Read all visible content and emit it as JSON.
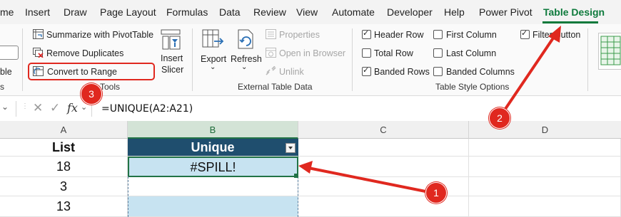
{
  "menu": {
    "items": [
      "me",
      "Insert",
      "Draw",
      "Page Layout",
      "Formulas",
      "Data",
      "Review",
      "View",
      "Automate",
      "Developer",
      "Help",
      "Power Pivot",
      "Table Design"
    ],
    "active": "Table Design"
  },
  "ribbon": {
    "left_partial_label": "ble",
    "tools": {
      "summarize": "Summarize with PivotTable",
      "remove_duplicates": "Remove Duplicates",
      "convert_to_range": "Convert to Range",
      "insert_slicer_line1": "Insert",
      "insert_slicer_line2": "Slicer",
      "group_label": "Tools",
      "group_label_partial_left": "s"
    },
    "external": {
      "export": "Export",
      "refresh": "Refresh",
      "properties": "Properties",
      "open_in_browser": "Open in Browser",
      "unlink": "Unlink",
      "group_label": "External Table Data"
    },
    "style_options": {
      "header_row": {
        "label": "Header Row",
        "checked": true
      },
      "total_row": {
        "label": "Total Row",
        "checked": false
      },
      "banded_rows": {
        "label": "Banded Rows",
        "checked": true
      },
      "first_column": {
        "label": "First Column",
        "checked": false
      },
      "last_column": {
        "label": "Last Column",
        "checked": false
      },
      "banded_columns": {
        "label": "Banded Columns",
        "checked": false
      },
      "filter_button": {
        "label": "Filter Button",
        "checked": true
      },
      "group_label": "Table Style Options"
    }
  },
  "formula_bar": {
    "fx": "fx",
    "formula": "=UNIQUE(A2:A21)"
  },
  "grid": {
    "columns": [
      "A",
      "B",
      "C",
      "D"
    ],
    "cells": {
      "a1": "List",
      "a2": "18",
      "a3": "3",
      "a4": "13",
      "b1": "Unique",
      "b2": "#SPILL!"
    }
  },
  "callouts": [
    "1",
    "2",
    "3"
  ],
  "colors": {
    "accent_green": "#0e7a3c",
    "table_header": "#1f4e6e",
    "spill_fill": "#c7e3f1",
    "callout_red": "#e0281f"
  }
}
